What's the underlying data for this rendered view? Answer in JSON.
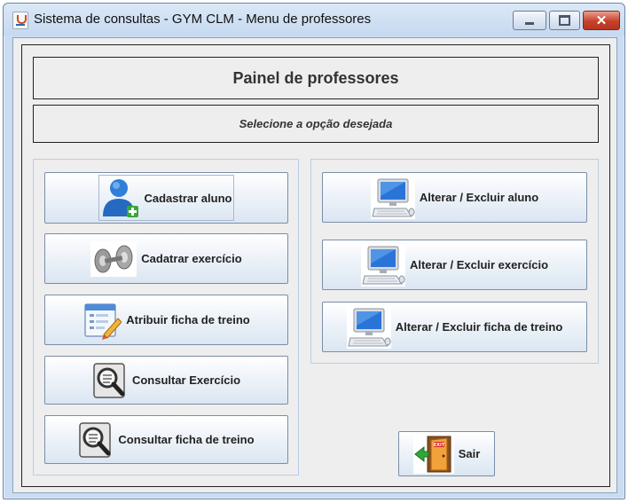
{
  "window": {
    "title": "Sistema de consultas - GYM CLM - Menu de professores",
    "minimize_icon": "minimize-icon",
    "maximize_icon": "maximize-icon",
    "close_label": "✕"
  },
  "header": {
    "title": "Painel de professores",
    "subtitle": "Selecione a opção desejada"
  },
  "left_buttons": [
    {
      "label": "Cadastrar aluno",
      "icon": "user-add-icon"
    },
    {
      "label": "Cadatrar exercício",
      "icon": "dumbbell-icon"
    },
    {
      "label": "Atribuir ficha de treino",
      "icon": "edit-form-icon"
    },
    {
      "label": "Consultar Exercício",
      "icon": "magnifier-icon"
    },
    {
      "label": "Consultar ficha de treino",
      "icon": "magnifier-icon"
    }
  ],
  "right_buttons": [
    {
      "label": "Alterar / Excluir aluno",
      "icon": "computer-icon"
    },
    {
      "label": "Alterar / Excluir exercício",
      "icon": "computer-icon"
    },
    {
      "label": "Alterar / Excluir ficha de treino",
      "icon": "computer-icon"
    }
  ],
  "exit_button": {
    "label": "Sair",
    "icon": "exit-door-icon"
  },
  "colors": {
    "titlebar": "#c6d9f0",
    "panel_border": "#b8cfe6",
    "close_button": "#c7402a",
    "button_gradient_bottom": "#dbe6f2"
  }
}
